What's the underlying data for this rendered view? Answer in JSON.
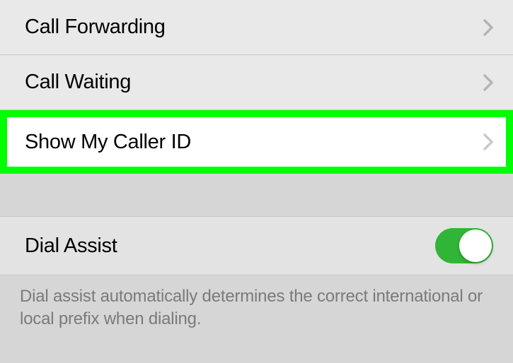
{
  "calls_section": {
    "items": [
      {
        "label": "Call Forwarding"
      },
      {
        "label": "Call Waiting"
      },
      {
        "label": "Show My Caller ID",
        "highlighted": true
      }
    ]
  },
  "dial_assist_section": {
    "label": "Dial Assist",
    "toggle_on": true,
    "footer": "Dial assist automatically determines the correct international or local prefix when dialing."
  }
}
